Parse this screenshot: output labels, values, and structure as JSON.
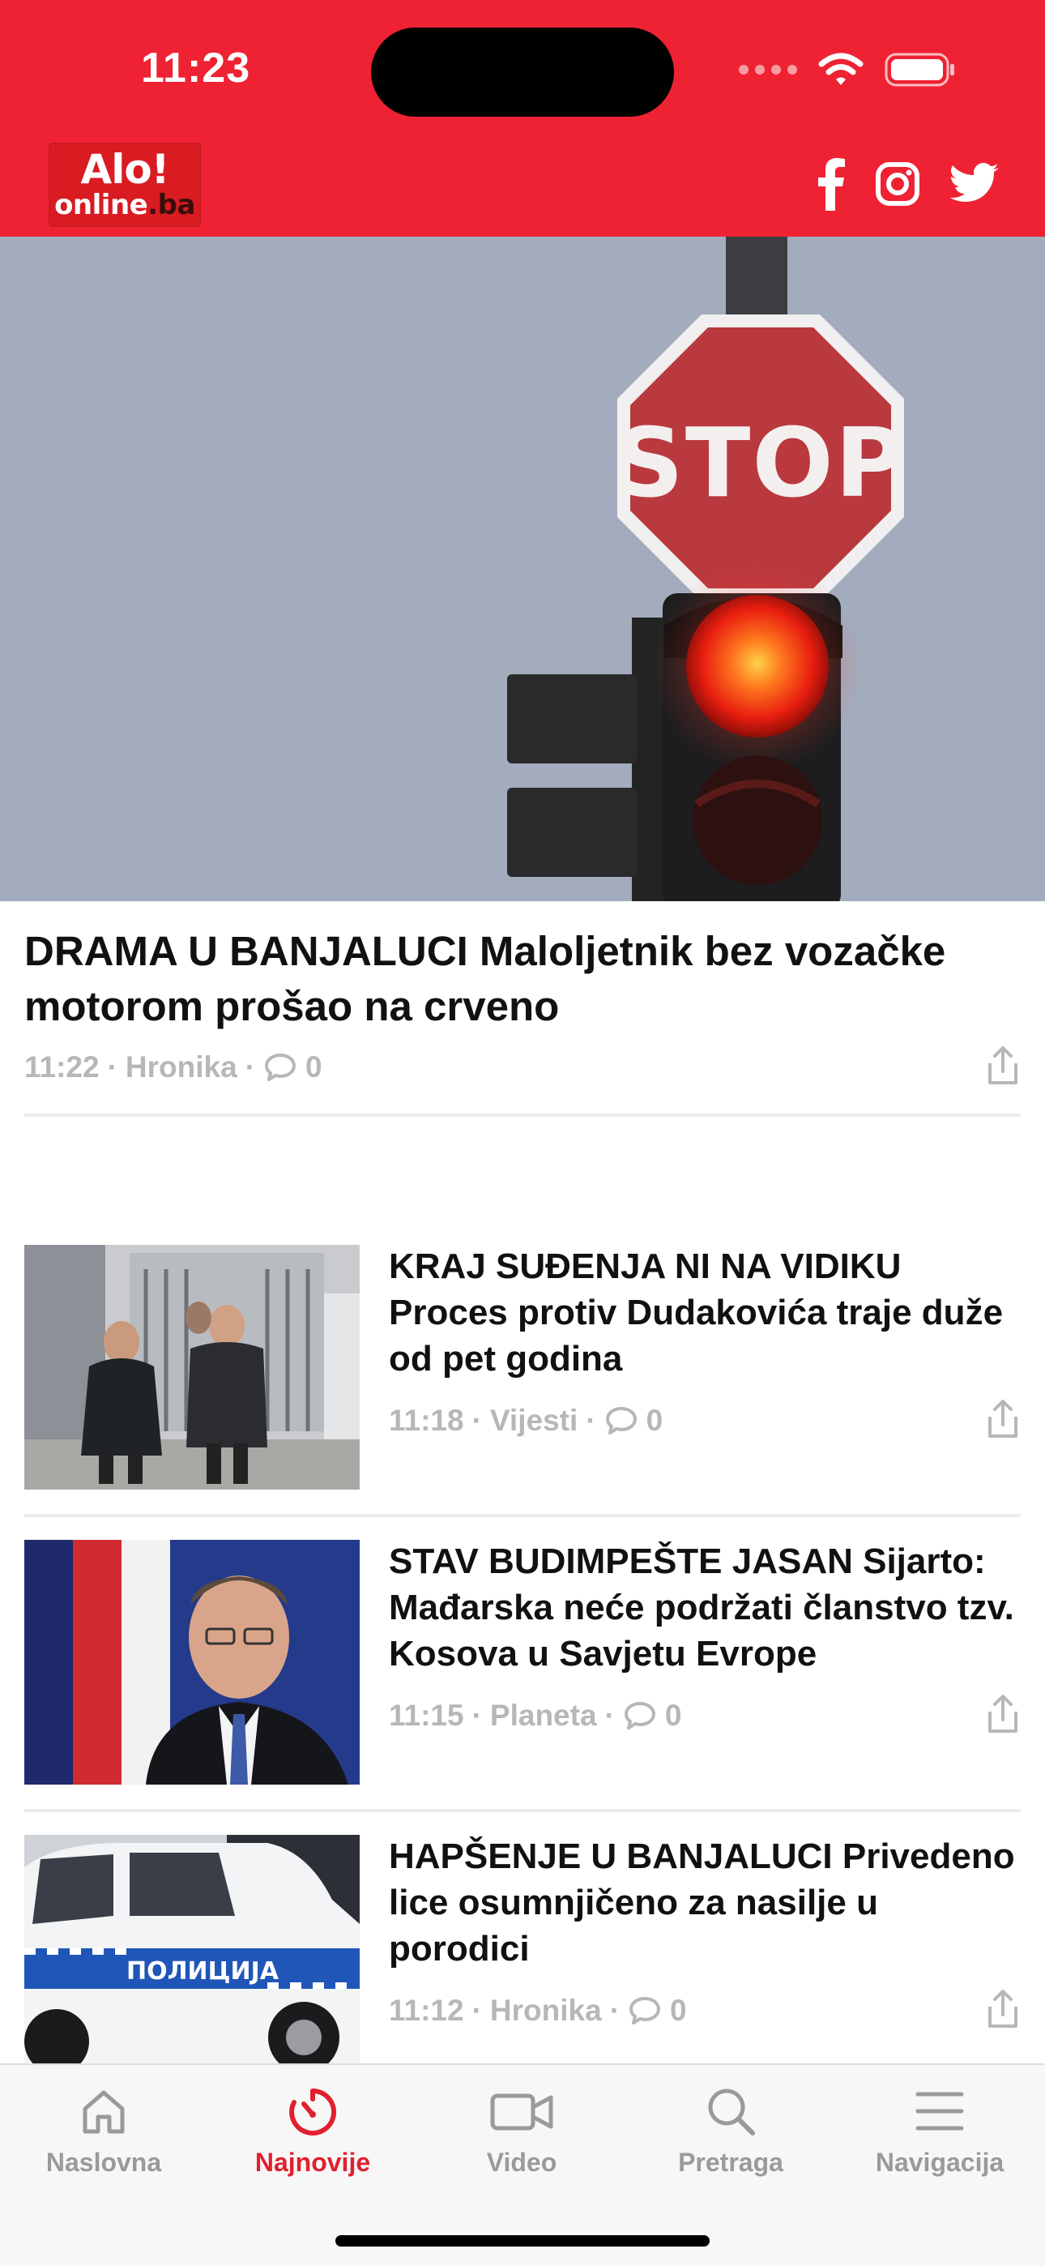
{
  "status_bar": {
    "time": "11:23"
  },
  "header": {
    "logo_top": "Alo!",
    "logo_bottom_main": "online",
    "logo_bottom_tld": ".ba",
    "social_icons": [
      "facebook-icon",
      "instagram-icon",
      "twitter-icon"
    ]
  },
  "lead_article": {
    "title": "DRAMA U BANJALUCI Maloljetnik bez vozačke motorom prošao na crveno",
    "time": "11:22",
    "category": "Hronika",
    "comments": "0",
    "image_sign_text": "STOP"
  },
  "articles": [
    {
      "title": "KRAJ SUĐENJA NI NA VIDIKU Proces protiv Dudakovića traje duže od pet godina",
      "time": "11:18",
      "category": "Vijesti",
      "comments": "0"
    },
    {
      "title": "STAV BUDIMPEŠTE JASAN Sijarto: Mađarska neće podržati članstvo tzv. Kosova u Savjetu Evrope",
      "time": "11:15",
      "category": "Planeta",
      "comments": "0"
    },
    {
      "title": "HAPŠENJE U BANJALUCI Privedeno lice osumnjičeno za nasilje u porodici",
      "time": "11:12",
      "category": "Hronika",
      "comments": "0",
      "image_car_text": "ПОЛИЦИЈА"
    }
  ],
  "meta_separator": "·",
  "tabbar": {
    "active": "Najnovije",
    "tabs": [
      {
        "label": "Naslovna",
        "icon": "home-icon"
      },
      {
        "label": "Najnovije",
        "icon": "clock-icon"
      },
      {
        "label": "Video",
        "icon": "video-icon"
      },
      {
        "label": "Pretraga",
        "icon": "search-icon"
      },
      {
        "label": "Navigacija",
        "icon": "menu-icon"
      }
    ]
  },
  "colors": {
    "brand_red": "#ee2233",
    "active_tab": "#e0202f",
    "meta_gray": "#b7b7b7",
    "inactive_tab": "#9a9a9a"
  }
}
